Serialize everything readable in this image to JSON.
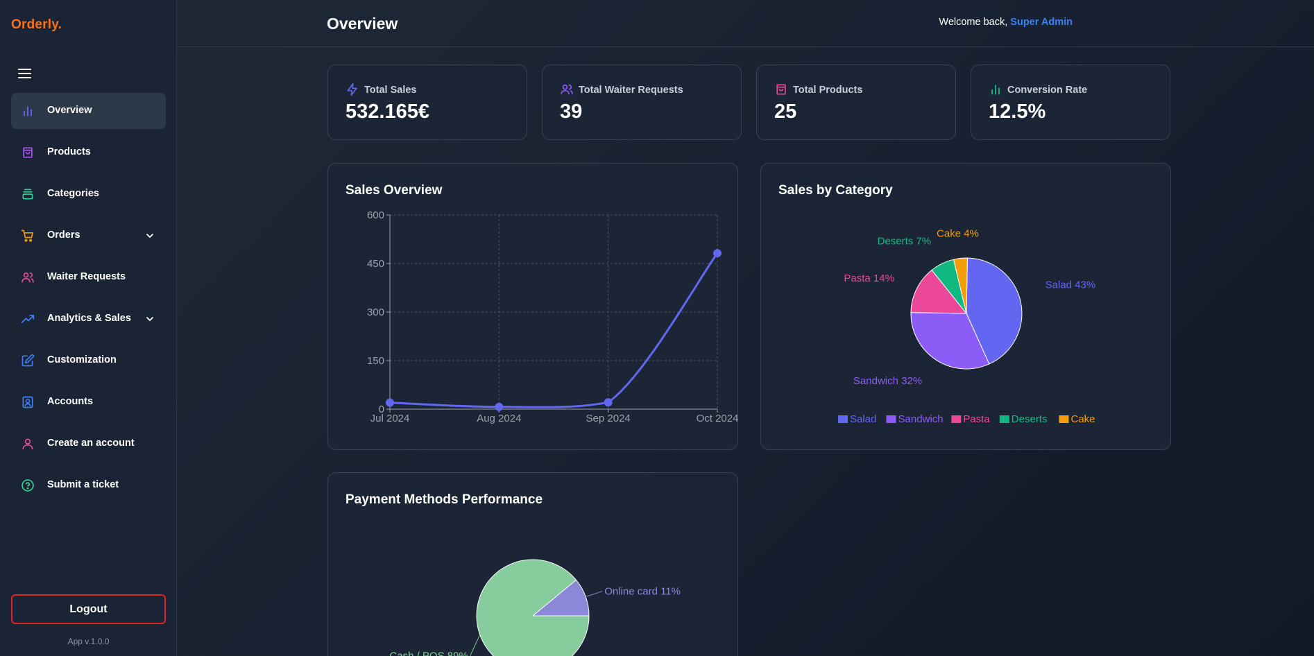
{
  "app": {
    "logo": "Orderly.",
    "version": "App v.1.0.0"
  },
  "sidebar": {
    "items": [
      {
        "label": "Overview",
        "icon": "bar-chart-icon",
        "color": "#6366f1",
        "active": true
      },
      {
        "label": "Products",
        "icon": "shopping-bag-icon",
        "color": "#a855f7"
      },
      {
        "label": "Categories",
        "icon": "layers-icon",
        "color": "#34d399"
      },
      {
        "label": "Orders",
        "icon": "cart-icon",
        "color": "#f59e0b",
        "expandable": true
      },
      {
        "label": "Waiter Requests",
        "icon": "users-icon",
        "color": "#ec4899"
      },
      {
        "label": "Analytics & Sales",
        "icon": "trending-up-icon",
        "color": "#3b82f6",
        "expandable": true
      },
      {
        "label": "Customization",
        "icon": "edit-icon",
        "color": "#3b82f6"
      },
      {
        "label": "Accounts",
        "icon": "contact-icon",
        "color": "#3b82f6"
      },
      {
        "label": "Create an account",
        "icon": "user-icon",
        "color": "#ec4899"
      },
      {
        "label": "Submit a ticket",
        "icon": "help-circle-icon",
        "color": "#34d399"
      }
    ],
    "logout_label": "Logout"
  },
  "header": {
    "title": "Overview",
    "welcome_prefix": "Welcome back,",
    "user_name": "Super Admin"
  },
  "stats": [
    {
      "label": "Total Sales",
      "value": "532.165€",
      "icon": "zap-icon",
      "color": "#6366f1"
    },
    {
      "label": "Total Waiter Requests",
      "value": "39",
      "icon": "users-icon",
      "color": "#8b5cf6"
    },
    {
      "label": "Total Products",
      "value": "25",
      "icon": "shopping-bag-icon",
      "color": "#ec4899"
    },
    {
      "label": "Conversion Rate",
      "value": "12.5%",
      "icon": "bar-chart-icon",
      "color": "#10b981"
    }
  ],
  "panels": {
    "sales_overview": "Sales Overview",
    "sales_by_category": "Sales by Category",
    "payment_methods": "Payment Methods Performance"
  },
  "chart_data": [
    {
      "type": "line",
      "title": "Sales Overview",
      "x": [
        "Jul 2024",
        "Aug 2024",
        "Sep 2024",
        "Oct 2024"
      ],
      "series": [
        {
          "values": [
            20,
            7,
            21,
            482
          ],
          "color": "#6366f1"
        }
      ],
      "ylim": [
        0,
        600
      ],
      "yticks": [
        0,
        150,
        300,
        450,
        600
      ],
      "grid": true
    },
    {
      "type": "pie",
      "title": "Sales by Category",
      "slices": [
        {
          "label": "Salad",
          "value": 43,
          "color": "#6366f1"
        },
        {
          "label": "Sandwich",
          "value": 32,
          "color": "#8b5cf6"
        },
        {
          "label": "Pasta",
          "value": 14,
          "color": "#ec4899"
        },
        {
          "label": "Deserts",
          "value": 7,
          "color": "#10b981"
        },
        {
          "label": "Cake",
          "value": 4,
          "color": "#f59e0b"
        }
      ],
      "legend": "bottom"
    },
    {
      "type": "pie",
      "title": "Payment Methods Performance",
      "slices": [
        {
          "label": "Online card",
          "value": 11,
          "color": "#8b87d9"
        },
        {
          "label": "Cash / POS",
          "value": 89,
          "color": "#86cc9c"
        }
      ]
    }
  ]
}
